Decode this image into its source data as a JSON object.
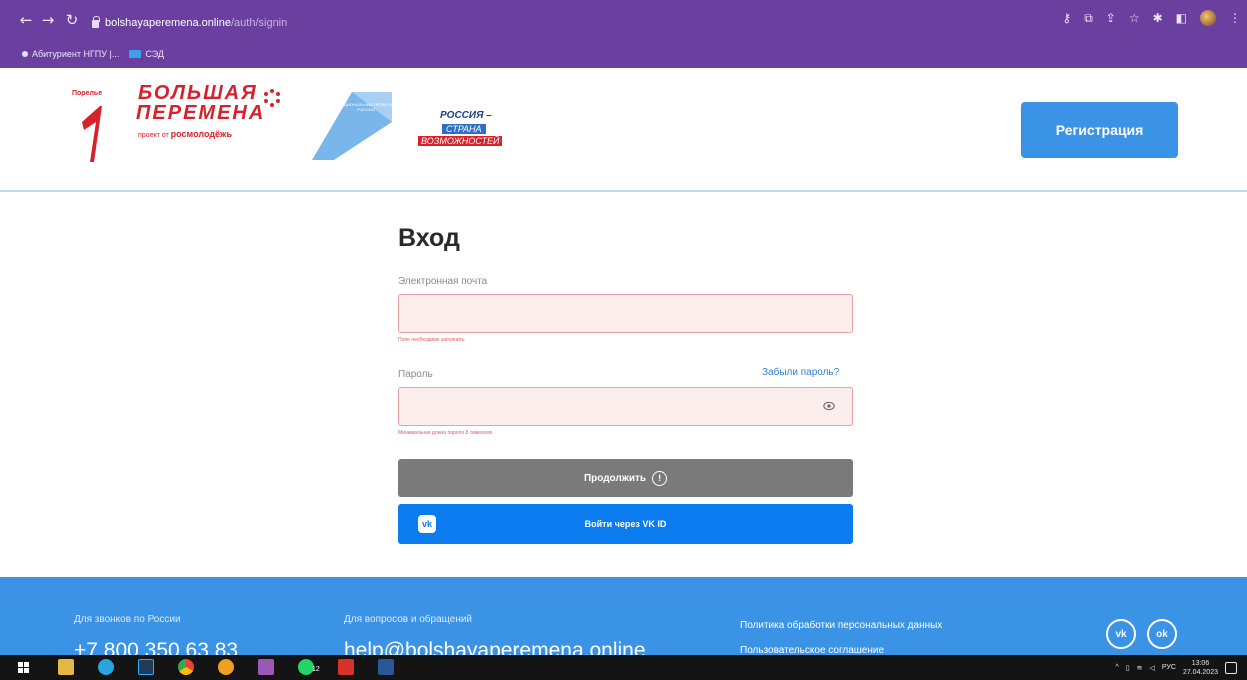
{
  "browser": {
    "url_host": "bolshayaperemena.online",
    "url_path": "/auth/signin",
    "bookmarks": [
      "Абитуриент НГПУ |...",
      "СЭД"
    ]
  },
  "header": {
    "logo": {
      "pora": "Порелье",
      "line1": "БОЛЬШАЯ",
      "line2": "ПЕРЕМЕНА",
      "sub_prefix": "проект от",
      "sub_brand": "росмолодёжь",
      "natproj_text": "НАЦИОНАЛЬНЫЕ ПРОЕКТЫ РОССИИ",
      "rossia_l1": "РОССИЯ –",
      "rossia_l2": "СТРАНА",
      "rossia_l3": "ВОЗМОЖНОСТЕЙ"
    },
    "register_label": "Регистрация"
  },
  "form": {
    "title": "Вход",
    "email_label": "Электронная почта",
    "email_value": "",
    "email_error": "Поле необходимо заполнить",
    "password_label": "Пароль",
    "forgot_label": "Забыли пароль?",
    "password_value": "",
    "password_error": "Минимальная длина пароля 8 символов",
    "continue_label": "Продолжить",
    "vk_label": "Войти через VK ID"
  },
  "footer": {
    "phone_label": "Для звонков по России",
    "phone": "+7 800 350 63 83",
    "email_label": "Для вопросов и обращений",
    "email": "help@bolshayaperemena.online",
    "policy": "Политика обработки персональных данных",
    "agreement": "Пользовательское соглашение",
    "social": [
      "vk",
      "ok"
    ]
  },
  "taskbar": {
    "lang": "РУС",
    "time": "13:06",
    "date": "27.04.2023",
    "whatsapp_badge": "12"
  },
  "colors": {
    "chrome": "#6b3fa0",
    "brand_blue": "#3b93e6",
    "brand_red": "#d9212b",
    "vk_blue": "#0a7cf0",
    "error_bg": "#fdeeee"
  }
}
